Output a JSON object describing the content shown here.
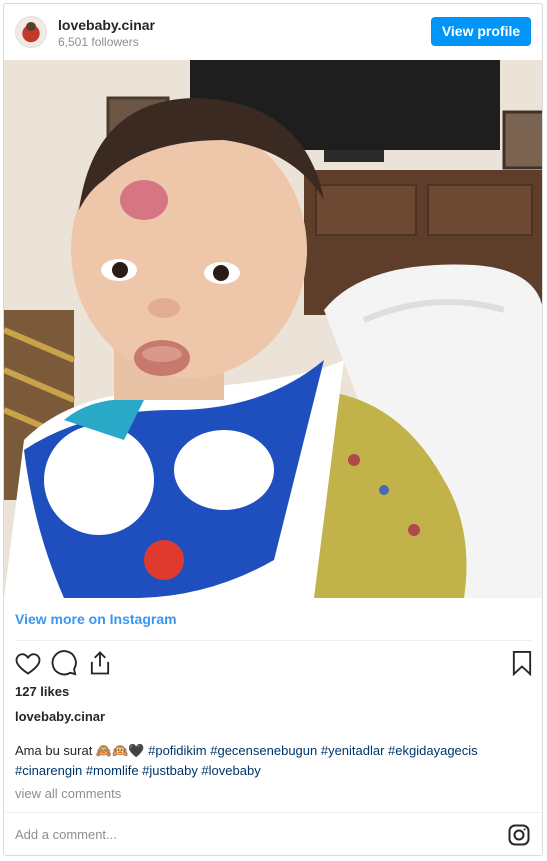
{
  "header": {
    "username": "lovebaby.cinar",
    "followers": "6,501 followers",
    "view_profile_label": "View profile"
  },
  "media": {
    "view_more_label": "View more on Instagram"
  },
  "actions": {
    "like_icon": "heart-icon",
    "comment_icon": "comment-icon",
    "share_icon": "share-icon",
    "save_icon": "bookmark-icon"
  },
  "post": {
    "likes": "127 likes",
    "author": "lovebaby.cinar",
    "caption_line1_text": "Ama bu surat 🙈🙉🖤 ",
    "caption_line1_tags": "#pofidikim #gecensenebugun #yenitadlar #ekgidayagecis",
    "caption_line2_tags": "#cinarengin #momlife #justbaby #lovebaby",
    "view_all_comments": "view all comments"
  },
  "comment_box": {
    "placeholder": "Add a comment...",
    "icon": "instagram-icon"
  },
  "colors": {
    "primary_button": "#0095f6",
    "link_blue": "#3897f0",
    "hashtag": "#003569"
  }
}
